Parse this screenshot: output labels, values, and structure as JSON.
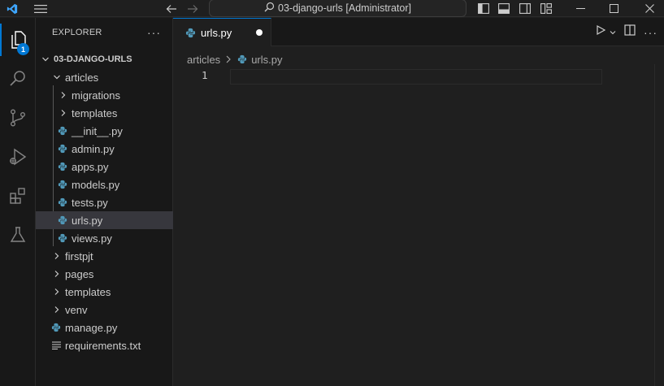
{
  "titlebar": {
    "search_text": "03-django-urls [Administrator]",
    "icons": [
      "vscode-logo-icon",
      "menu-icon",
      "back-arrow-icon",
      "forward-arrow-icon",
      "search-icon",
      "toggle-sidebar-icon",
      "toggle-panel-icon",
      "toggle-secondary-sidebar-icon",
      "customize-layout-icon",
      "minimize-icon",
      "maximize-icon",
      "close-icon"
    ]
  },
  "activitybar": {
    "explorer_badge": "1",
    "items": [
      "explorer-icon",
      "search-icon",
      "source-control-icon",
      "run-debug-icon",
      "extensions-icon",
      "testing-icon"
    ]
  },
  "sidebar": {
    "title": "EXPLORER",
    "more": "···",
    "project": "03-DJANGO-URLS",
    "tree": [
      {
        "label": "articles",
        "type": "folder-open"
      },
      {
        "label": "migrations",
        "type": "folder"
      },
      {
        "label": "templates",
        "type": "folder"
      },
      {
        "label": "__init__.py",
        "type": "python"
      },
      {
        "label": "admin.py",
        "type": "python"
      },
      {
        "label": "apps.py",
        "type": "python"
      },
      {
        "label": "models.py",
        "type": "python"
      },
      {
        "label": "tests.py",
        "type": "python"
      },
      {
        "label": "urls.py",
        "type": "python",
        "selected": true
      },
      {
        "label": "views.py",
        "type": "python"
      },
      {
        "label": "firstpjt",
        "type": "folder"
      },
      {
        "label": "pages",
        "type": "folder"
      },
      {
        "label": "templates",
        "type": "folder"
      },
      {
        "label": "venv",
        "type": "folder"
      },
      {
        "label": "manage.py",
        "type": "python"
      },
      {
        "label": "requirements.txt",
        "type": "text"
      }
    ]
  },
  "editor": {
    "tab_label": "urls.py",
    "breadcrumb": [
      "articles",
      "urls.py"
    ],
    "line_number": "1"
  },
  "colors": {
    "accent": "#0078d4",
    "python_icon": "#519aba",
    "selection": "#37373d"
  }
}
